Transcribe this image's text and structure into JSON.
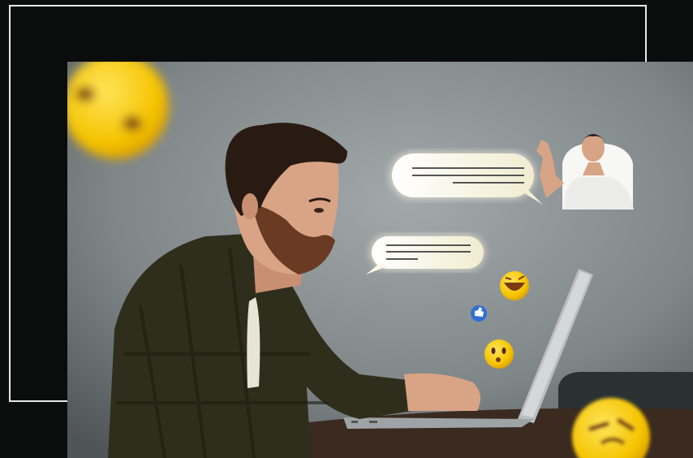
{
  "scene": {
    "background_color": "#0b0c0c",
    "frame_color": "#e8e8e8",
    "wall_color": "#8d9496",
    "shirt_color": "#2f2e1c",
    "hair_color": "#2a1b12",
    "skin_color": "#d9a486",
    "laptop_color": "#b9bec1",
    "table_color": "#3a2a20",
    "emoji_color": "#f5c400",
    "bubble_color": "#f7f5ea",
    "like_color": "#2f6fd6"
  }
}
